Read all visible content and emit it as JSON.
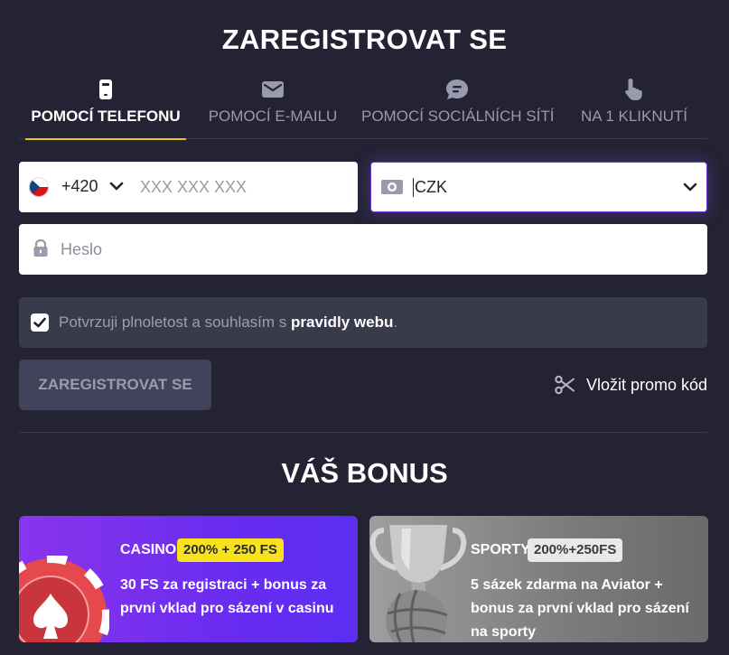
{
  "header": {
    "title": "ZAREGISTROVAT SE"
  },
  "tabs": [
    {
      "label": "POMOCÍ TELEFONU",
      "icon": "phone-icon",
      "active": true
    },
    {
      "label": "POMOCÍ E-MAILU",
      "icon": "envelope-icon",
      "active": false
    },
    {
      "label": "POMOCÍ SOCIÁLNÍCH SÍTÍ",
      "icon": "chat-bubble-icon",
      "active": false
    },
    {
      "label": "NA 1 KLIKNUTÍ",
      "icon": "pointer-hand-icon",
      "active": false
    }
  ],
  "form": {
    "phone": {
      "country_flag": "czech-flag-icon",
      "dial_code": "+420",
      "placeholder": "XXX XXX XXX",
      "value": ""
    },
    "currency": {
      "value": "CZK"
    },
    "password": {
      "placeholder": "Heslo",
      "value": ""
    },
    "consent": {
      "text_before": "Potvrzuji plnoletost a souhlasím s ",
      "link_text": "pravidly webu",
      "text_after": ".",
      "checked": true
    },
    "submit_label": "ZAREGISTROVAT SE",
    "promo_label": "Vložit promo kód"
  },
  "bonus": {
    "title": "VÁŠ BONUS",
    "cards": [
      {
        "name": "CASINO",
        "badge": "200% + 250 FS",
        "description": "30 FS za registraci + bonus za první vklad pro sázení v casinu"
      },
      {
        "name": "SPORTY",
        "badge": "200%+250FS",
        "description": "5 sázek zdarma na Aviator + bonus za první vklad pro sázení na sporty"
      }
    ]
  },
  "colors": {
    "background": "#232334",
    "accent_underline": "#f2c01e",
    "casino_gradient": "#8a35ec",
    "casino_badge": "#f8e21d",
    "sport_badge": "#e9e9e9",
    "focus_border": "#6f3ad8"
  }
}
